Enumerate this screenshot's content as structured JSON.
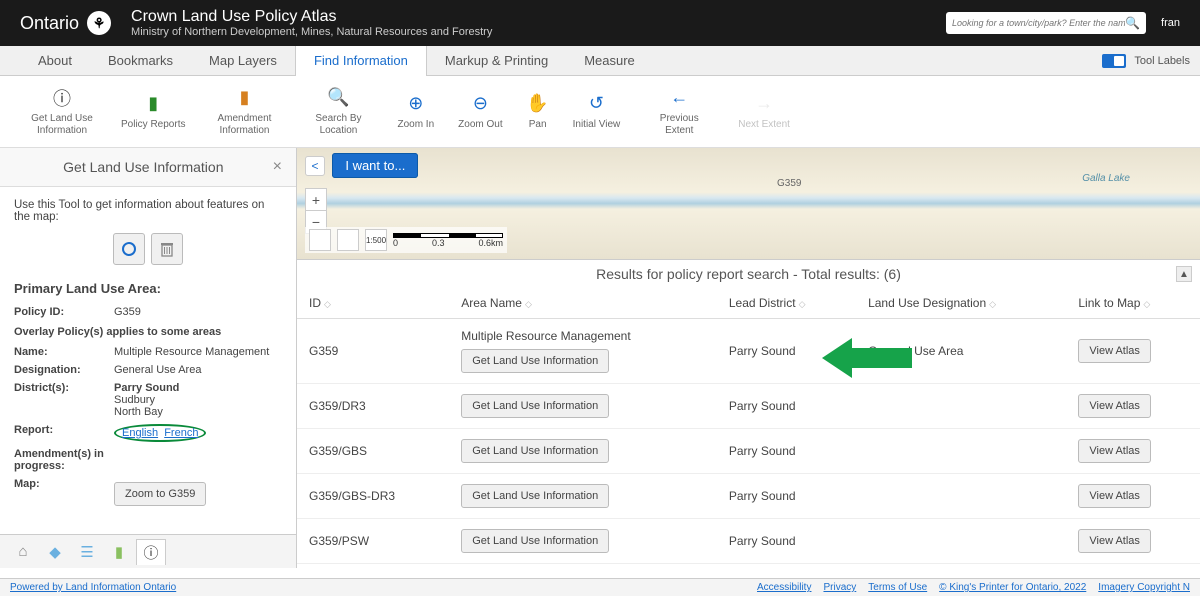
{
  "header": {
    "logo_text": "Ontario",
    "logo_symbol": "⚘",
    "app_title": "Crown Land Use Policy Atlas",
    "ministry": "Ministry of Northern Development, Mines, Natural Resources and Forestry",
    "search_placeholder": "Looking for a town/city/park? Enter the name here",
    "lang": "fran"
  },
  "tabs": {
    "items": [
      "About",
      "Bookmarks",
      "Map Layers",
      "Find Information",
      "Markup & Printing",
      "Measure"
    ],
    "active": 3,
    "tool_labels": "Tool Labels"
  },
  "toolbar": [
    {
      "icon": "ⓘ",
      "label": "Get Land Use Information",
      "color": "#333"
    },
    {
      "icon": "▮",
      "label": "Policy Reports",
      "color": "#2a8a2a"
    },
    {
      "icon": "▮",
      "label": "Amendment Information",
      "color": "#d68020"
    },
    {
      "icon": "🔍",
      "label": "Search By Location",
      "color": "#555"
    },
    {
      "icon": "⊕",
      "label": "Zoom In",
      "color": "#1a6dcc"
    },
    {
      "icon": "⊖",
      "label": "Zoom Out",
      "color": "#1a6dcc"
    },
    {
      "icon": "✋",
      "label": "Pan",
      "color": "#d68020"
    },
    {
      "icon": "↺",
      "label": "Initial View",
      "color": "#1a6dcc"
    },
    {
      "icon": "←",
      "label": "Previous Extent",
      "color": "#1a6dcc"
    },
    {
      "icon": "→",
      "label": "Next Extent",
      "color": "#ccc",
      "disabled": true
    }
  ],
  "panel": {
    "title": "Get Land Use Information",
    "intro": "Use this Tool to get information about features on the map:",
    "section_title": "Primary Land Use Area:",
    "rows": {
      "policy_id_label": "Policy ID:",
      "policy_id_value": "G359",
      "overlay_note": "Overlay Policy(s) applies to some areas",
      "name_label": "Name:",
      "name_value": "Multiple Resource Management",
      "designation_label": "Designation:",
      "designation_value": "General Use Area",
      "districts_label": "District(s):",
      "district1": "Parry Sound",
      "district2": "Sudbury",
      "district3": "North Bay",
      "report_label": "Report:",
      "report_en": "English",
      "report_fr": "French",
      "amendments_label": "Amendment(s) in progress:",
      "map_label": "Map:",
      "zoom_btn": "Zoom to G359"
    }
  },
  "map": {
    "back": "<",
    "i_want_to": "I want to...",
    "polygon_label": "G359",
    "lake_label": "Galla Lake",
    "scale_text": "1:500",
    "scale_0": "0",
    "scale_mid": "0.3",
    "scale_end": "0.6km"
  },
  "results": {
    "header": "Results for policy report search - Total results: (6)",
    "columns": [
      "ID",
      "Area Name",
      "Lead District",
      "Land Use Designation",
      "Link to Map"
    ],
    "get_info_btn": "Get Land Use Information",
    "view_atlas_btn": "View Atlas",
    "rows": [
      {
        "id": "G359",
        "area_name": "Multiple Resource Management",
        "lead_district": "Parry Sound",
        "designation": "General Use Area"
      },
      {
        "id": "G359/DR3",
        "area_name": "",
        "lead_district": "Parry Sound",
        "designation": ""
      },
      {
        "id": "G359/GBS",
        "area_name": "",
        "lead_district": "Parry Sound",
        "designation": ""
      },
      {
        "id": "G359/GBS-DR3",
        "area_name": "",
        "lead_district": "Parry Sound",
        "designation": ""
      },
      {
        "id": "G359/PSW",
        "area_name": "",
        "lead_district": "Parry Sound",
        "designation": ""
      }
    ]
  },
  "footer": {
    "left": "Powered by Land Information Ontario",
    "links": [
      "Accessibility",
      "Privacy",
      "Terms of Use",
      "© King's Printer for Ontario, 2022",
      "Imagery Copyright N"
    ]
  }
}
